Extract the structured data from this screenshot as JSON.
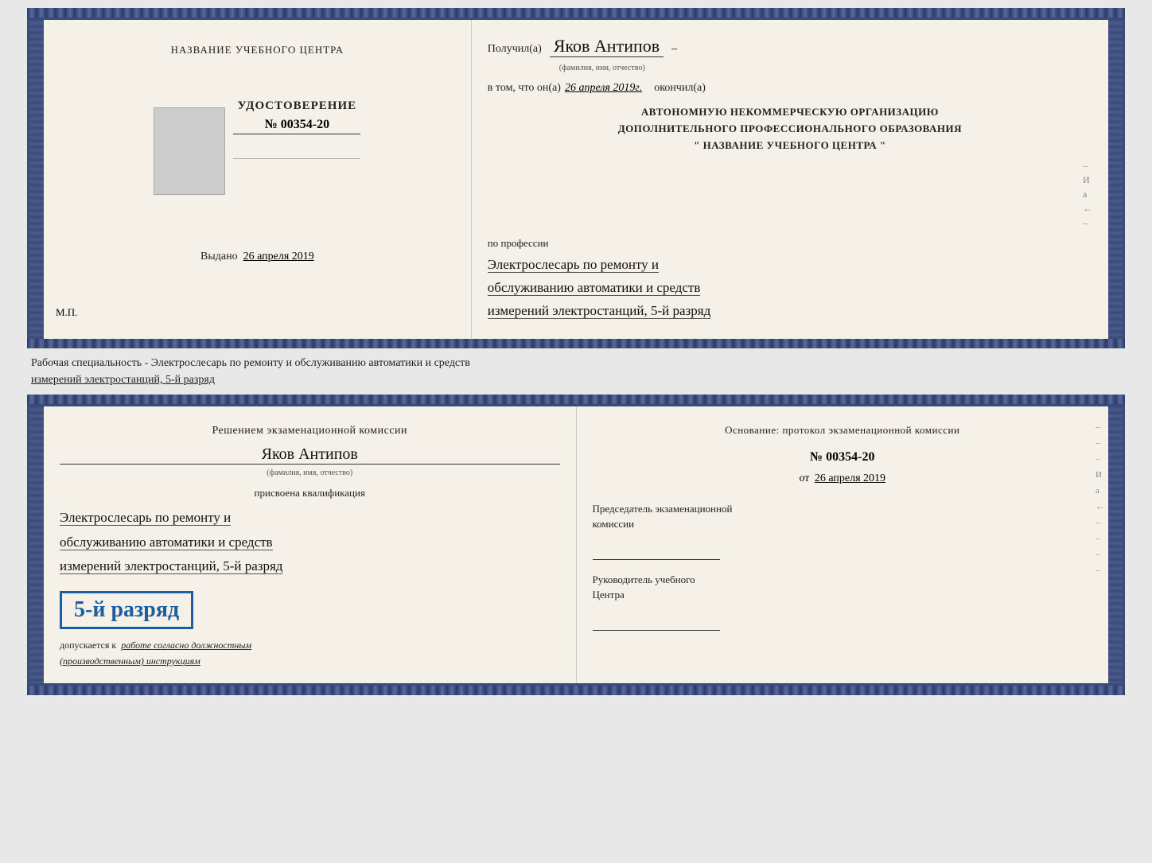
{
  "page": {
    "background": "#e8e8e8"
  },
  "topCert": {
    "left": {
      "trainingCenterLabel": "НАЗВАНИЕ УЧЕБНОГО ЦЕНТРА",
      "udostoverenie": "УДОСТОВЕРЕНИЕ",
      "number": "№ 00354-20",
      "issuedLabel": "Выдано",
      "issuedDate": "26 апреля 2019",
      "mp": "М.П."
    },
    "right": {
      "poluchilLabel": "Получил(а)",
      "poluchilValue": "Яков Антипов",
      "familySubLabel": "(фамилия, имя, отчество)",
      "vTomLabel": "в том, что он(а)",
      "vTomDate": "26 апреля 2019г.",
      "okonchilLabel": "окончил(а)",
      "orgLine1": "АВТОНОМНУЮ НЕКОММЕРЧЕСКУЮ ОРГАНИЗАЦИЮ",
      "orgLine2": "ДОПОЛНИТЕЛЬНОГО ПРОФЕССИОНАЛЬНОГО ОБРАЗОВАНИЯ",
      "orgLine3": "\"  НАЗВАНИЕ УЧЕБНОГО ЦЕНТРА  \"",
      "professiiLabel": "по профессии",
      "profession1": "Электрослесарь по ремонту и",
      "profession2": "обслуживанию автоматики и средств",
      "profession3": "измерений электростанций, 5-й разряд"
    }
  },
  "separatorText": {
    "line1": "Рабочая специальность - Электрослесарь по ремонту и обслуживанию автоматики и средств",
    "line2": "измерений электростанций, 5-й разряд"
  },
  "bottomCert": {
    "left": {
      "reshenieHeader": "Решением экзаменационной комиссии",
      "name": "Яков Антипов",
      "familySubLabel": "(фамилия, имя, отчество)",
      "prisvoenaLabel": "присвоена квалификация",
      "qualification1": "Электрослесарь по ремонту и",
      "qualification2": "обслуживанию автоматики и средств",
      "qualification3": "измерений электростанций, 5-й разряд",
      "rankBadge": "5-й разряд",
      "dopuskaetsyaLabel": "допускается к",
      "dopuskaetsyaValue": "работе согласно должностным",
      "instrLabel": "(производственным) инструкциям"
    },
    "right": {
      "osnovanieLabelLine1": "Основание: протокол экзаменационной  комиссии",
      "protocolNumber": "№  00354-20",
      "otLabel": "от",
      "otDate": "26 апреля 2019",
      "predsedatelLabel": "Председатель экзаменационной",
      "predsedatelLabel2": "комиссии",
      "rukovoditelLabel": "Руководитель учебного",
      "rukovoditelLabel2": "Центра",
      "rightMarks": [
        "И",
        "а",
        "←",
        "–",
        "–",
        "–",
        "–"
      ]
    }
  }
}
